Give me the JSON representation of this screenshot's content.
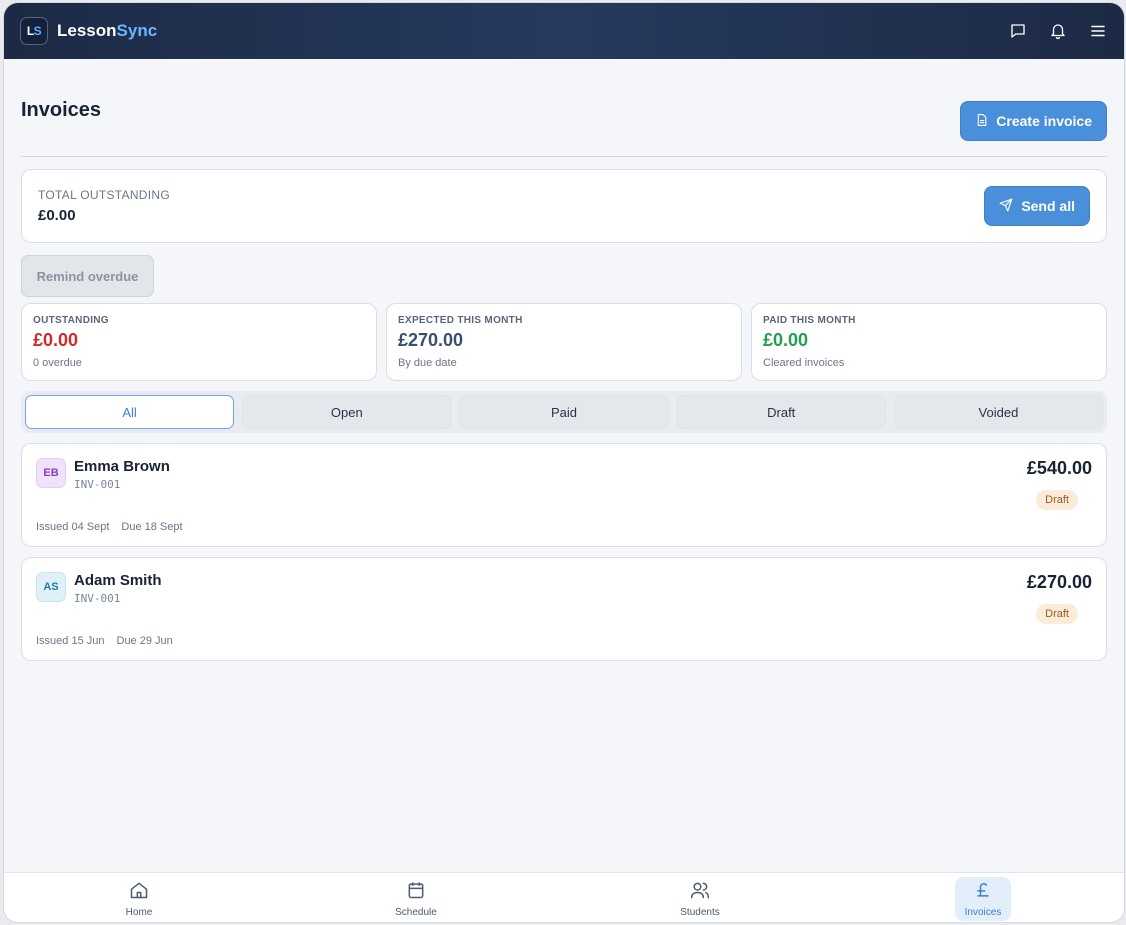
{
  "app": {
    "logo_text_l": "L",
    "logo_text_s": "S",
    "brand_main": "Lesson",
    "brand_accent": "Sync",
    "icons": [
      "chat-icon",
      "bell-icon",
      "menu-icon"
    ]
  },
  "page": {
    "title": "Invoices",
    "create_label": "Create invoice"
  },
  "outstanding": {
    "label": "TOTAL OUTSTANDING",
    "value": "£0.00",
    "send_all_label": "Send all"
  },
  "remind_label": "Remind overdue",
  "stats": [
    {
      "label": "OUTSTANDING",
      "value": "£0.00",
      "sub": "0 overdue",
      "color": "#d02b2b"
    },
    {
      "label": "EXPECTED THIS MONTH",
      "value": "£270.00",
      "sub": "By due date",
      "color": "#3a4e6e"
    },
    {
      "label": "PAID THIS MONTH",
      "value": "£0.00",
      "sub": "Cleared invoices",
      "color": "#22a04f"
    }
  ],
  "tabs": [
    {
      "label": "All",
      "active": true
    },
    {
      "label": "Open",
      "active": false
    },
    {
      "label": "Paid",
      "active": false
    },
    {
      "label": "Draft",
      "active": false
    },
    {
      "label": "Voided",
      "active": false
    }
  ],
  "invoices": [
    {
      "initials": "EB",
      "name": "Emma Brown",
      "number": "INV-001",
      "issued": "Issued 04 Sept",
      "due": "Due 18 Sept",
      "amount": "£540.00",
      "status": "Draft",
      "avatar_bg": "#f1e2fb",
      "avatar_fg": "#8a3fc0"
    },
    {
      "initials": "AS",
      "name": "Adam Smith",
      "number": "INV-001",
      "issued": "Issued 15 Jun",
      "due": "Due 29 Jun",
      "amount": "£270.00",
      "status": "Draft",
      "avatar_bg": "#dff0f7",
      "avatar_fg": "#1f7ea1"
    }
  ],
  "nav": [
    {
      "label": "Home",
      "icon": "home-icon",
      "active": false
    },
    {
      "label": "Schedule",
      "icon": "calendar-icon",
      "active": false
    },
    {
      "label": "Students",
      "icon": "users-icon",
      "active": false
    },
    {
      "label": "Invoices",
      "icon": "pound-icon",
      "active": true
    }
  ]
}
